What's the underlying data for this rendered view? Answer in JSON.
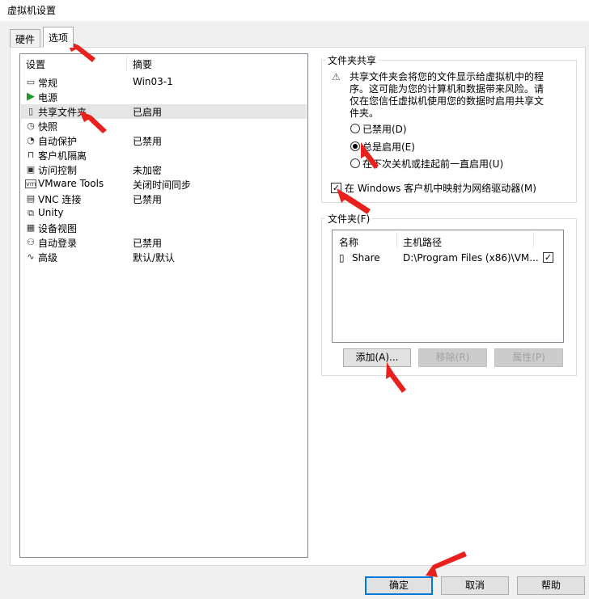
{
  "window": {
    "title": "虚拟机设置"
  },
  "tabs": [
    {
      "label": "硬件"
    },
    {
      "label": "选项"
    }
  ],
  "settings_list": {
    "col_setting": "设置",
    "col_summary": "摘要",
    "items": [
      {
        "label": "常规",
        "summary": "Win03-1",
        "icon": "monitor-icon"
      },
      {
        "label": "电源",
        "summary": "",
        "icon": "play-icon"
      },
      {
        "label": "共享文件夹",
        "summary": "已启用",
        "icon": "shared-folder-icon"
      },
      {
        "label": "快照",
        "summary": "",
        "icon": "snapshot-icon"
      },
      {
        "label": "自动保护",
        "summary": "已禁用",
        "icon": "clock-icon"
      },
      {
        "label": "客户机隔离",
        "summary": "",
        "icon": "lock-icon"
      },
      {
        "label": "访问控制",
        "summary": "未加密",
        "icon": "access-control-icon"
      },
      {
        "label": "VMware Tools",
        "summary": "关闭时间同步",
        "icon": "vm-icon"
      },
      {
        "label": "VNC 连接",
        "summary": "已禁用",
        "icon": "vnc-icon"
      },
      {
        "label": "Unity",
        "summary": "",
        "icon": "unity-icon"
      },
      {
        "label": "设备视图",
        "summary": "",
        "icon": "device-view-icon"
      },
      {
        "label": "自动登录",
        "summary": "已禁用",
        "icon": "users-icon"
      },
      {
        "label": "高级",
        "summary": "默认/默认",
        "icon": "advanced-icon"
      }
    ]
  },
  "share_group": {
    "title": "文件夹共享",
    "warning": "共享文件夹会将您的文件显示给虚拟机中的程序。这可能为您的计算机和数据带来风险。请仅在您信任虚拟机使用您的数据时启用共享文件夹。",
    "radio_disabled": "已禁用(D)",
    "radio_always": "总是启用(E)",
    "radio_until": "在下次关机或挂起前一直启用(U)",
    "selected_radio": "always",
    "map_drive_label": "在 Windows 客户机中映射为网络驱动器(M)",
    "map_drive_checked": true
  },
  "folder_group": {
    "title": "文件夹(F)",
    "col_name": "名称",
    "col_path": "主机路径",
    "rows": [
      {
        "name": "Share",
        "path": "D:\\Program Files (x86)\\VM...",
        "enabled": true
      }
    ],
    "btn_add": "添加(A)...",
    "btn_remove": "移除(R)",
    "btn_props": "属性(P)"
  },
  "footer": {
    "ok": "确定",
    "cancel": "取消",
    "help": "帮助"
  },
  "colors": {
    "annotation_arrow": "#e8211c",
    "accent": "#0078d7"
  }
}
